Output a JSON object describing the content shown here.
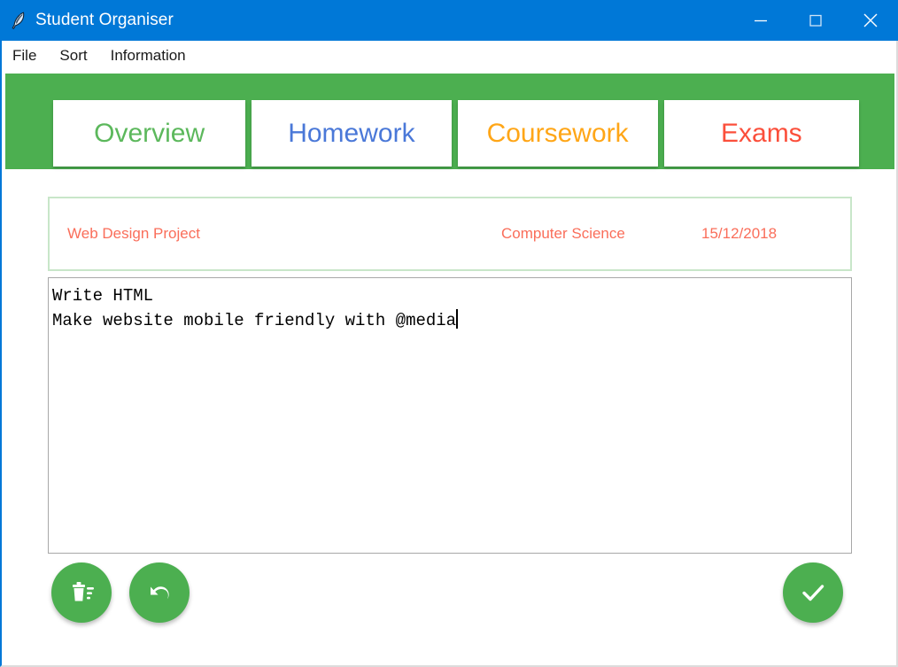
{
  "window": {
    "title": "Student Organiser",
    "app_icon": "feather-quill-icon",
    "accent_color": "#0078D7",
    "brand_green": "#4CAF50",
    "controls": {
      "minimize": "minimize-icon",
      "maximize": "maximize-icon",
      "close": "close-icon"
    }
  },
  "menu": {
    "items": [
      {
        "label": "File"
      },
      {
        "label": "Sort"
      },
      {
        "label": "Information"
      }
    ]
  },
  "tabs": [
    {
      "label": "Overview",
      "color": "#5CB85C",
      "selected": true
    },
    {
      "label": "Homework",
      "color": "#4A78D8",
      "selected": false
    },
    {
      "label": "Coursework",
      "color": "#FFA617",
      "selected": false
    },
    {
      "label": "Exams",
      "color": "#FB4F3B",
      "selected": false
    }
  ],
  "item": {
    "title": "Web Design Project",
    "subject": "Computer Science",
    "date": "15/12/2018",
    "text_color": "#FA6E5A",
    "border_color": "#c8e6c9"
  },
  "notes": {
    "value": "Write HTML\nMake website mobile friendly with @media",
    "lines": [
      "Write HTML",
      "Make website mobile friendly with @media"
    ],
    "caret_after": "@media"
  },
  "actions": [
    {
      "name": "delete-button",
      "icon": "trash-icon",
      "color": "#4CAF50"
    },
    {
      "name": "undo-button",
      "icon": "undo-arrow-icon",
      "color": "#4CAF50"
    },
    {
      "name": "confirm-button",
      "icon": "check-icon",
      "color": "#4CAF50"
    }
  ]
}
